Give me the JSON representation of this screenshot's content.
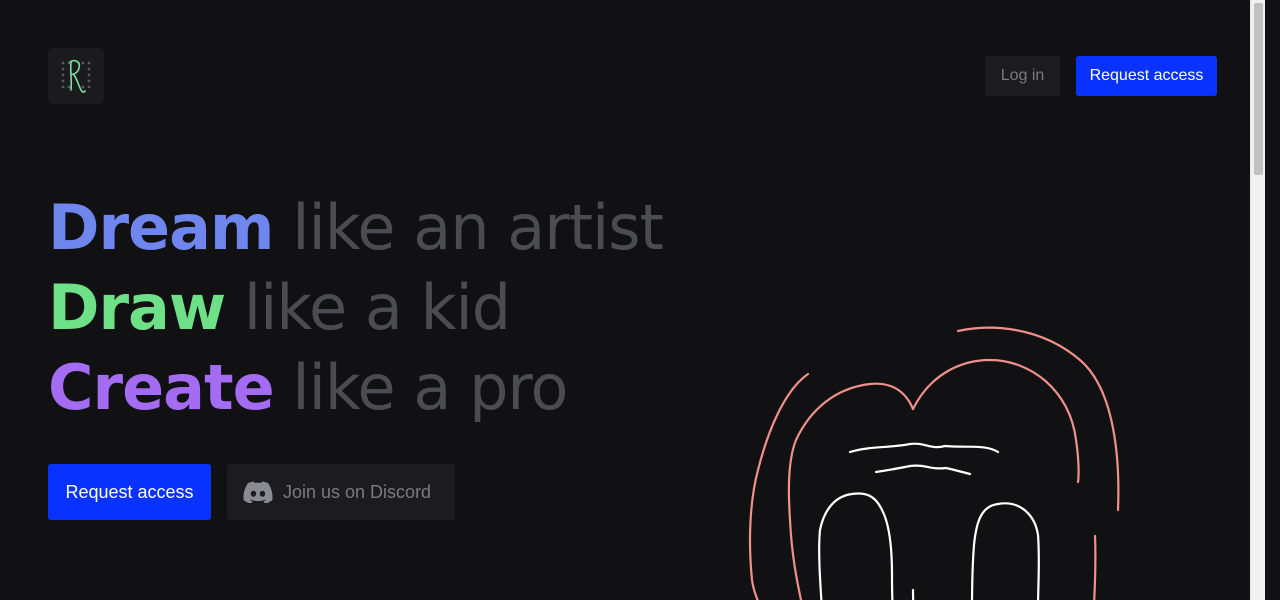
{
  "header": {
    "logo_icon": "app-logo-icon",
    "login_label": "Log in",
    "request_access_label": "Request access"
  },
  "hero": {
    "line1": {
      "strong": "Dream",
      "rest": "like an artist"
    },
    "line2": {
      "strong": "Draw",
      "rest": "like a kid"
    },
    "line3": {
      "strong": "Create",
      "rest": "like a pro"
    }
  },
  "cta": {
    "request_access_label": "Request access",
    "discord_label": "Join us on Discord",
    "discord_icon": "discord-icon"
  },
  "illustration": {
    "icon": "hand-drawn-sketch"
  },
  "colors": {
    "background": "#111113",
    "accent_blue": "#0a32ff",
    "dream": "#6f86ee",
    "draw": "#6ee087",
    "create": "#a46cf2",
    "muted_text": "#4b4b52",
    "sketch_outer": "#f0908a",
    "sketch_inner": "#ffffff"
  }
}
